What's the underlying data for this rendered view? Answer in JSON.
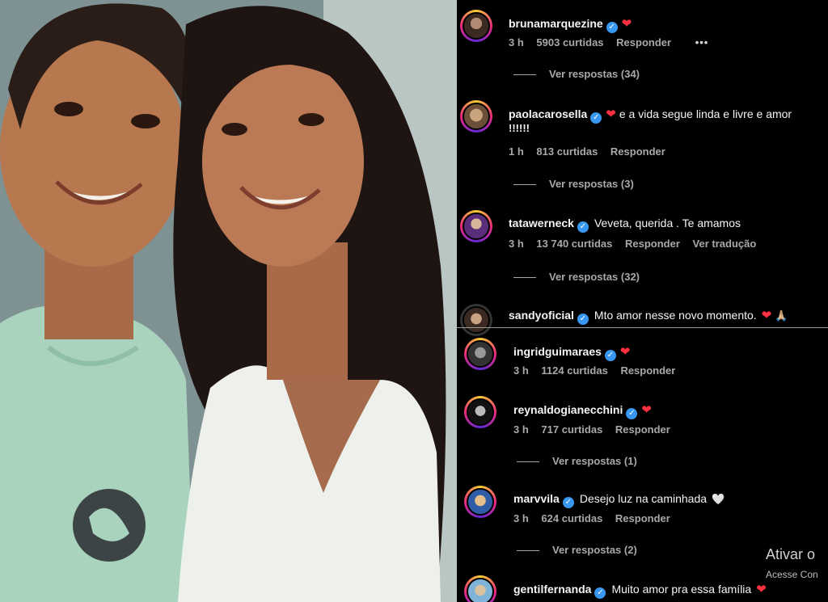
{
  "comments_top": [
    {
      "username": "brunamarquezine",
      "text": "",
      "heart": true,
      "time": "3 h",
      "likes": "5903 curtidas",
      "reply": "Responder",
      "extra": "",
      "more": true,
      "replies": "Ver respostas (34)"
    },
    {
      "username": "paolacarosella",
      "text": "e a vida segue linda e livre e amor",
      "text2": "!!!!!!",
      "heart": true,
      "time": "1 h",
      "likes": "813 curtidas",
      "reply": "Responder",
      "extra": "",
      "more": false,
      "replies": "Ver respostas (3)"
    },
    {
      "username": "tatawerneck",
      "text": "Veveta, querida . Te amamos",
      "heart": false,
      "time": "3 h",
      "likes": "13 740 curtidas",
      "reply": "Responder",
      "extra": "Ver tradução",
      "more": false,
      "replies": "Ver respostas (32)"
    },
    {
      "username": "sandyoficial",
      "text": "Mto amor nesse novo momento.",
      "heart": true,
      "emoji2": "🙏🏼"
    }
  ],
  "comments_bottom": [
    {
      "username": "ingridguimaraes",
      "text": "",
      "heart": true,
      "time": "3 h",
      "likes": "1124 curtidas",
      "reply": "Responder"
    },
    {
      "username": "reynaldogianecchini",
      "text": "",
      "heart": true,
      "time": "3 h",
      "likes": "717 curtidas",
      "reply": "Responder",
      "replies": "Ver respostas (1)"
    },
    {
      "username": "marvvila",
      "text": "Desejo luz na caminhada",
      "heart_white": "🤍",
      "time": "3 h",
      "likes": "624 curtidas",
      "reply": "Responder",
      "replies": "Ver respostas (2)"
    },
    {
      "username": "gentilfernanda",
      "text": "Muito amor pra essa família",
      "heart": true
    }
  ],
  "icons": {
    "verified": "✓",
    "heart": "❤",
    "more": "•••"
  },
  "watermark": {
    "line1": "Ativar o",
    "line2": "Acesse Con"
  },
  "colors": {
    "panel_bg": "#000000",
    "verified": "#3897f0",
    "heart": "#ff3040",
    "muted": "#a8a8a8"
  }
}
